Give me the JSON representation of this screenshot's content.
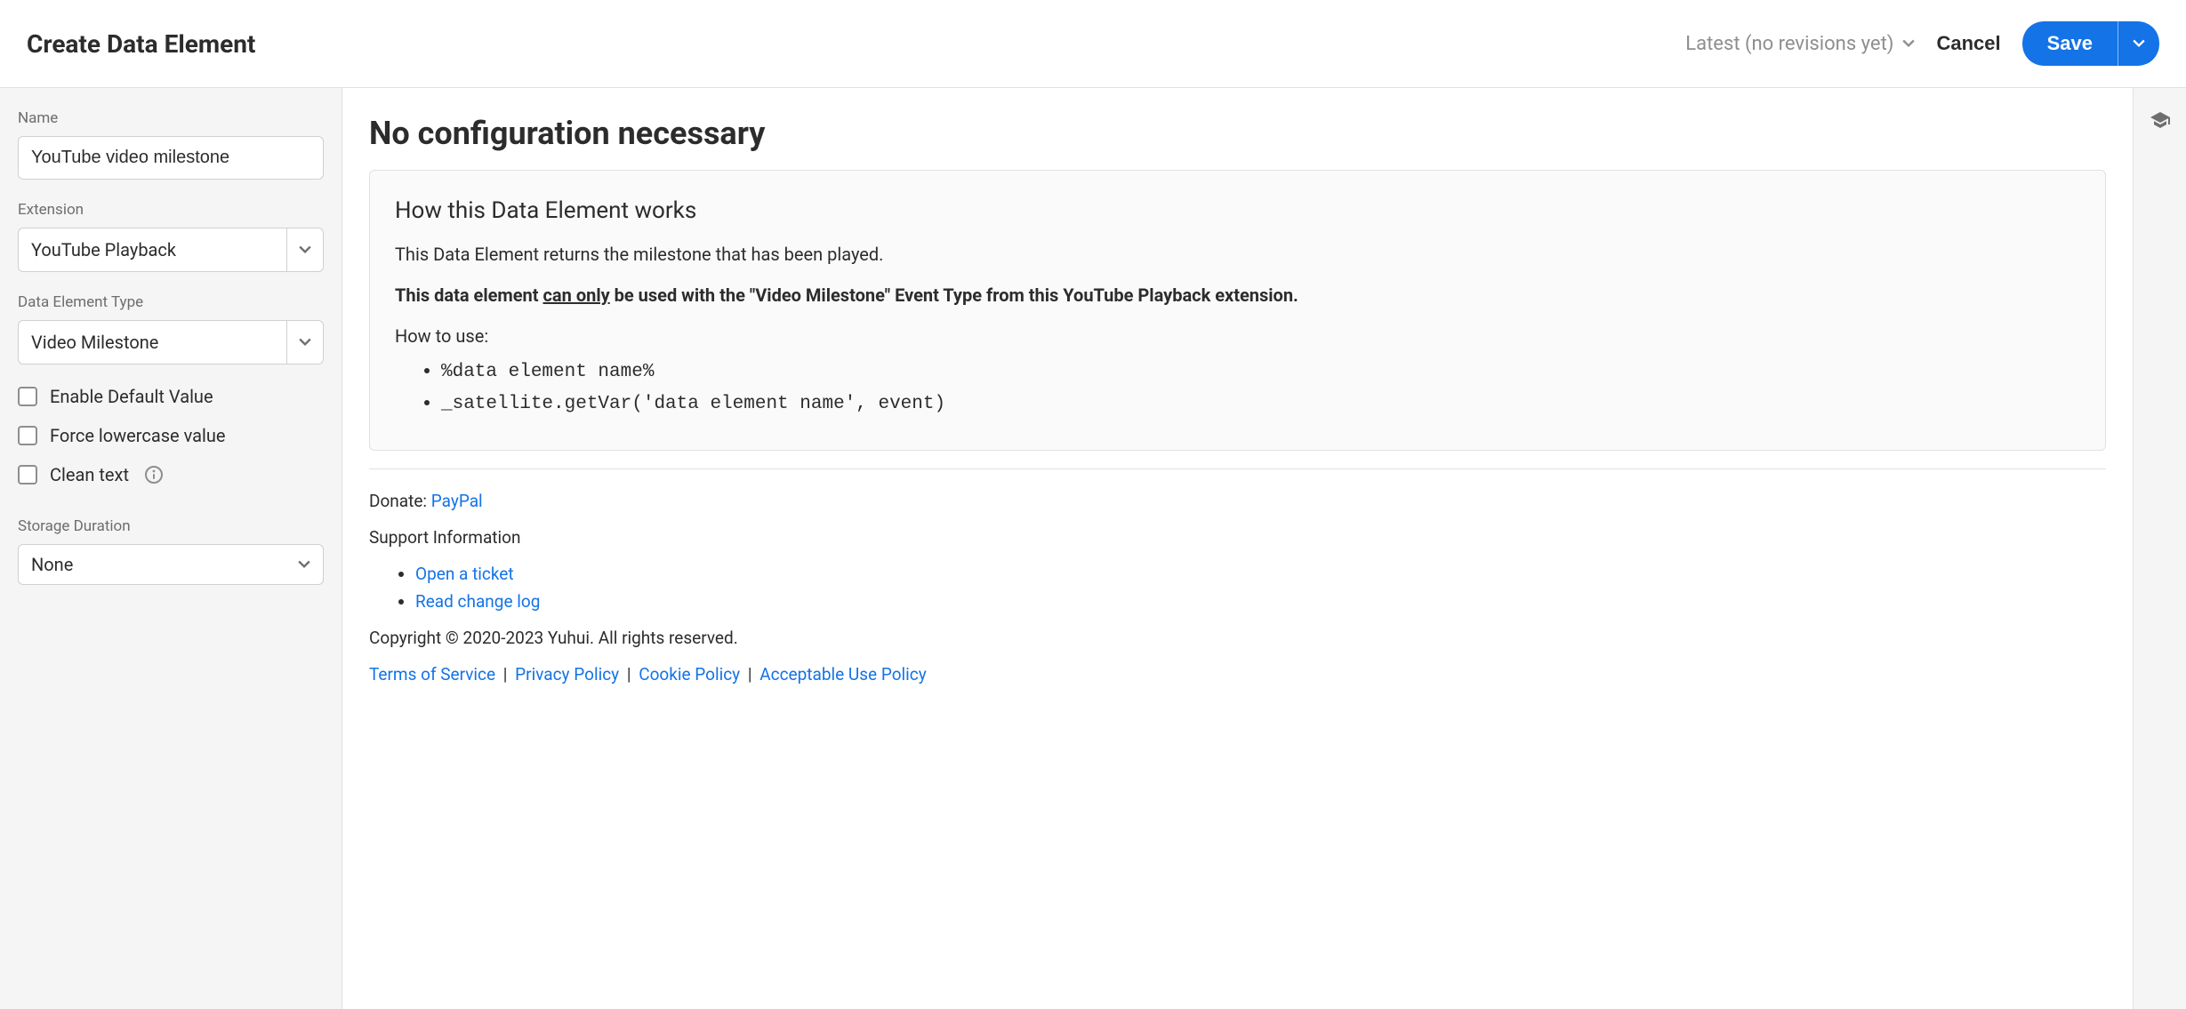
{
  "header": {
    "title": "Create Data Element",
    "revision_label": "Latest (no revisions yet)",
    "cancel_label": "Cancel",
    "save_label": "Save"
  },
  "sidebar": {
    "name_label": "Name",
    "name_value": "YouTube video milestone",
    "extension_label": "Extension",
    "extension_value": "YouTube Playback",
    "type_label": "Data Element Type",
    "type_value": "Video Milestone",
    "enable_default_label": "Enable Default Value",
    "force_lowercase_label": "Force lowercase value",
    "clean_text_label": "Clean text",
    "storage_label": "Storage Duration",
    "storage_value": "None"
  },
  "main": {
    "heading": "No configuration necessary",
    "box_heading": "How this Data Element works",
    "box_p1": "This Data Element returns the milestone that has been played.",
    "box_p2_prefix": "This data element ",
    "box_p2_underline": "can only",
    "box_p2_suffix": " be used with the \"Video Milestone\" Event Type from this YouTube Playback extension.",
    "box_p3": "How to use:",
    "code1": "%data element name%",
    "code2": "_satellite.getVar('data element name', event)"
  },
  "footer": {
    "donate_label": "Donate: ",
    "donate_link": "PayPal",
    "support_label": "Support Information",
    "link_ticket": "Open a ticket",
    "link_changelog": "Read change log",
    "copyright": "Copyright © 2020-2023 Yuhui. All rights reserved.",
    "tos": "Terms of Service",
    "privacy": "Privacy Policy",
    "cookie": "Cookie Policy",
    "aup": "Acceptable Use Policy"
  }
}
